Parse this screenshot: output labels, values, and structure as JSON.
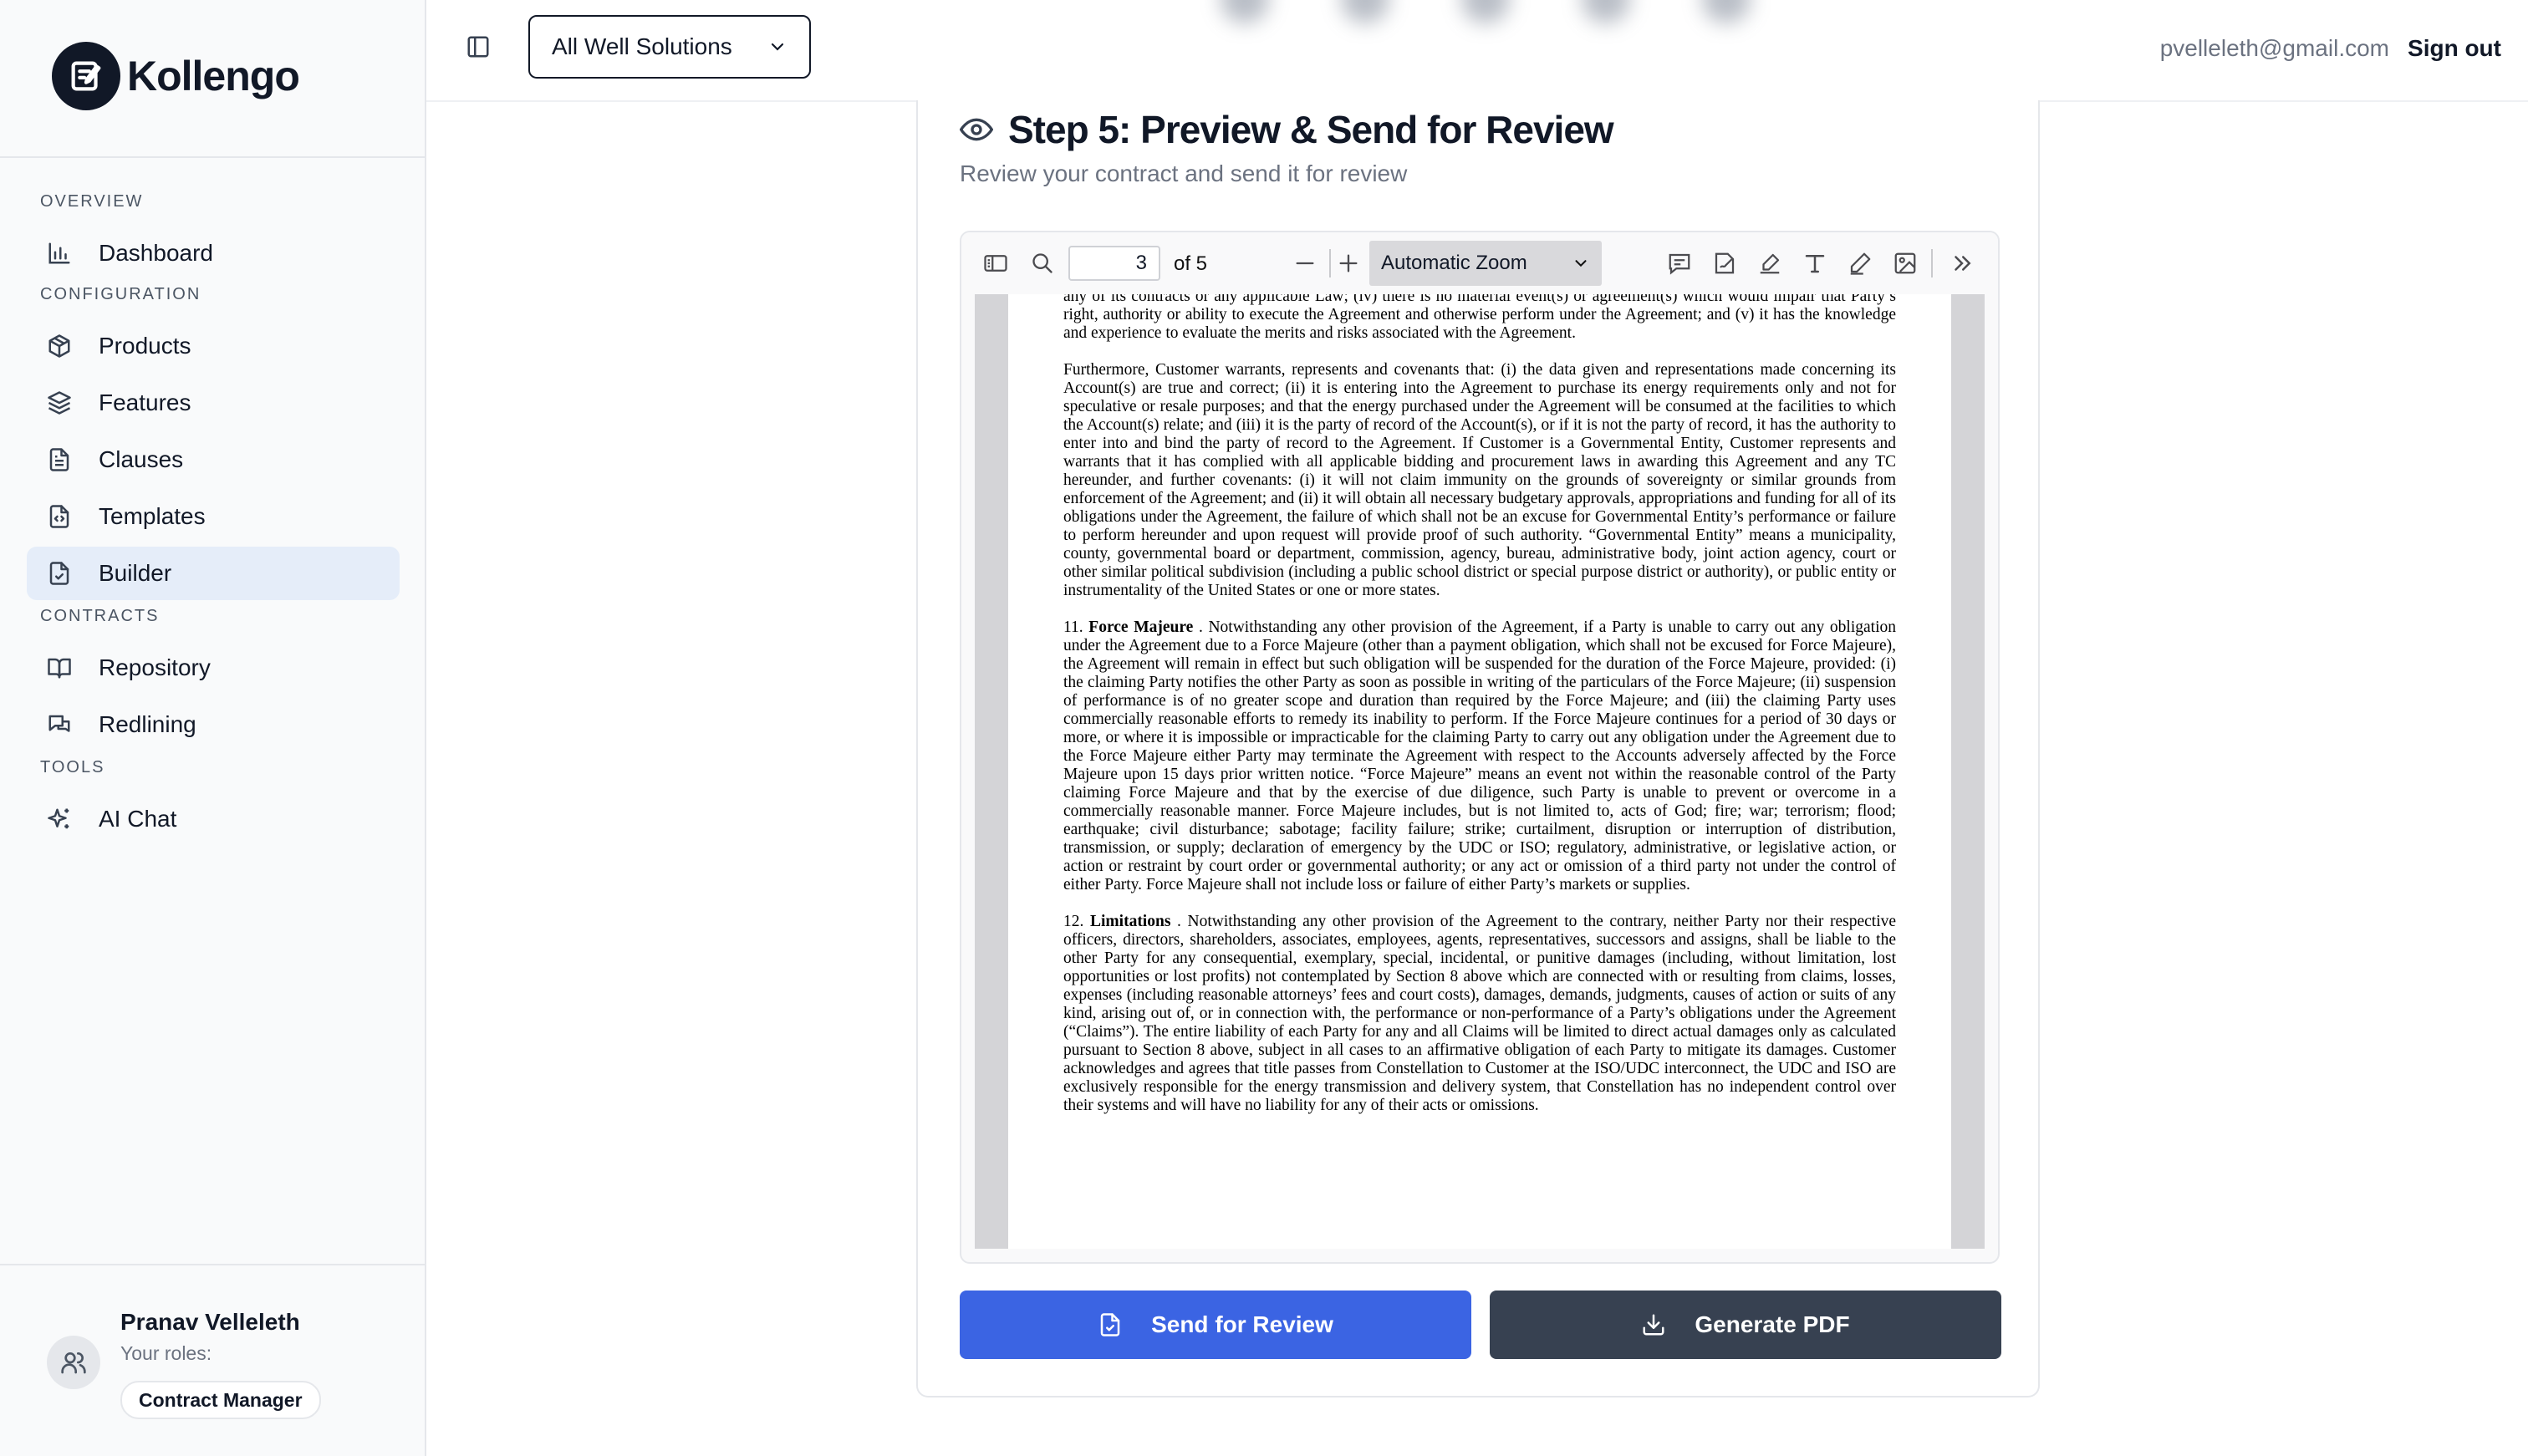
{
  "brand": {
    "name": "Kollengo"
  },
  "sidebar": {
    "sections": [
      {
        "title": "OVERVIEW",
        "items": [
          {
            "label": "Dashboard",
            "icon": "bar-chart-icon"
          }
        ]
      },
      {
        "title": "CONFIGURATION",
        "items": [
          {
            "label": "Products",
            "icon": "box-icon"
          },
          {
            "label": "Features",
            "icon": "layers-icon"
          },
          {
            "label": "Clauses",
            "icon": "document-icon"
          },
          {
            "label": "Templates",
            "icon": "file-code-icon"
          },
          {
            "label": "Builder",
            "icon": "file-check-icon",
            "active": true
          }
        ]
      },
      {
        "title": "CONTRACTS",
        "items": [
          {
            "label": "Repository",
            "icon": "book-open-icon"
          },
          {
            "label": "Redlining",
            "icon": "chat-bubbles-icon"
          }
        ]
      },
      {
        "title": "TOOLS",
        "items": [
          {
            "label": "AI Chat",
            "icon": "sparkles-icon"
          }
        ]
      }
    ],
    "user": {
      "name": "Pranav Velleleth",
      "roles_label": "Your roles:",
      "role": "Contract Manager"
    }
  },
  "header": {
    "workspace": "All Well Solutions",
    "email": "pvelleleth@gmail.com",
    "signout": "Sign out"
  },
  "step": {
    "title": "Step 5: Preview & Send for Review",
    "subtitle": "Review your contract and send it for review"
  },
  "viewer": {
    "page": "3",
    "page_of": "of 5",
    "zoom": "Automatic Zoom",
    "paragraphs": [
      "any of its contracts or any applicable Law; (iv) there is no material event(s) or agreement(s) which would impair that Party’s right, authority or ability to execute the Agreement and otherwise perform under the Agreement; and (v) it has the knowledge and experience to evaluate the merits and risks associated with the Agreement.",
      "Furthermore, Customer warrants, represents and covenants that: (i) the data given and representations made concerning its Account(s) are true and correct; (ii) it is entering into the Agreement to purchase its energy requirements only and not for speculative or resale purposes; and that the energy purchased under the Agreement will be consumed at the facilities to which the Account(s) relate; and (iii) it is the party of record of the Account(s), or if it is not the party of record, it has the authority to enter into and bind the party of record to the Agreement. If Customer is a Governmental Entity, Customer represents and warrants that it has complied with all applicable bidding and procurement laws in awarding this Agreement and any TC hereunder, and further covenants: (i) it will not claim immunity on the grounds of sovereignty or similar grounds from enforcement of the Agreement; and (ii) it will obtain all necessary budgetary approvals, appropriations and funding for all of its obligations under the Agreement, the failure of which shall not be an excuse for Governmental Entity’s performance or failure to perform hereunder and upon request will provide proof of such authority. “Governmental Entity” means a municipality, county, governmental board or department, commission, agency, bureau, administrative body, joint action agency, court or other similar political subdivision (including a public school district or special purpose district or authority), or public entity or instrumentality of the United States or one or more states."
    ],
    "force_majeure": {
      "num": "11.",
      "heading": "Force Majeure",
      "text": ". Notwithstanding any other provision of the Agreement, if a Party is unable to carry out any obligation under the Agreement due to a Force Majeure (other than a payment obligation, which shall not be excused for Force Majeure), the Agreement will remain in effect but such obligation will be suspended for the duration of the Force Majeure, provided: (i) the claiming Party notifies the other Party as soon as possible in writing of the particulars of the Force Majeure; (ii) suspension of performance is of no greater scope and duration than required by the Force Majeure; and (iii) the claiming Party uses commercially reasonable efforts to remedy its inability to perform. If the Force Majeure continues for a period of 30 days or more, or where it is impossible or impracticable for the claiming Party to carry out any obligation under the Agreement due to the Force Majeure either Party may terminate the Agreement with respect to the Accounts adversely affected by the Force Majeure upon 15 days prior written notice. “Force Majeure” means an event not within the reasonable control of the Party claiming Force Majeure and that by the exercise of due diligence, such Party is unable to prevent or overcome in a commercially reasonable manner. Force Majeure includes, but is not limited to, acts of God; fire; war; terrorism; flood; earthquake; civil disturbance; sabotage; facility failure; strike; curtailment, disruption or interruption of distribution, transmission, or supply; declaration of emergency by the UDC or ISO; regulatory, administrative, or legislative action, or action or restraint by court order or governmental authority; or any act or omission of a third party not under the control of either Party. Force Majeure shall not include loss or failure of either Party’s markets or supplies."
    },
    "limitations": {
      "num": "12.",
      "heading": "Limitations",
      "text": ". Notwithstanding any other provision of the Agreement to the contrary, neither Party nor their respective officers, directors, shareholders, associates, employees, agents, representatives, successors and assigns, shall be liable to the other Party for any consequential, exemplary, special, incidental, or punitive damages (including, without limitation, lost opportunities or lost profits) not contemplated by Section 8 above which are connected with or resulting from claims, losses, expenses (including reasonable attorneys’ fees and court costs), damages, demands, judgments, causes of action or suits of any kind, arising out of, or in connection with, the performance or non-performance of a Party’s obligations under the Agreement (“Claims”). The entire liability of each Party for any and all Claims will be limited to direct actual damages only as calculated pursuant to Section 8 above, subject in all cases to an affirmative obligation of each Party to mitigate its damages. Customer acknowledges and agrees that title passes from Constellation to Customer at the ISO/UDC interconnect, the UDC and ISO are exclusively responsible for the energy transmission and delivery system, that Constellation has no independent control over their systems and will have no liability for any of their acts or omissions."
    }
  },
  "actions": {
    "send": "Send for Review",
    "generate": "Generate PDF"
  },
  "colors": {
    "primary": "#3b64e3",
    "dark": "#374151",
    "active_bg": "#e5edf9"
  }
}
